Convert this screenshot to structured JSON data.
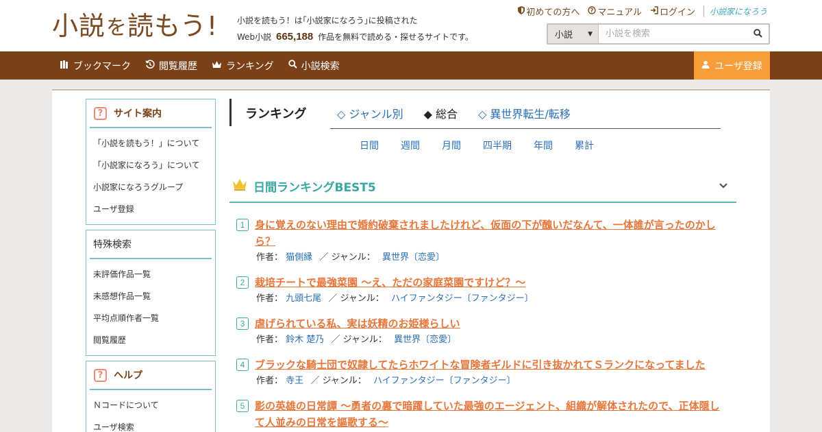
{
  "header": {
    "logo_parts": [
      "小説",
      "を",
      "読もう!"
    ],
    "tagline_line1": "小説を読もう！は｢小説家になろう｣に投稿された",
    "tagline_prefix": "Web小説",
    "work_count": "665,188",
    "tagline_suffix": "作品を無料で読める・探せるサイトです。",
    "links": [
      {
        "icon": "shield-icon",
        "label": "初めての方へ"
      },
      {
        "icon": "question-circle-icon",
        "label": "マニュアル"
      },
      {
        "icon": "login-icon",
        "label": "ログイン"
      }
    ],
    "brand_link": "小説家になろう",
    "search": {
      "category": "小説",
      "placeholder": "小説を検索"
    }
  },
  "nav": {
    "items": [
      {
        "icon": "books-icon",
        "label": "ブックマーク"
      },
      {
        "icon": "history-icon",
        "label": "閲覧履歴"
      },
      {
        "icon": "crown-icon",
        "label": "ランキング"
      },
      {
        "icon": "search-icon",
        "label": "小説検索"
      }
    ],
    "register": "ユーザ登録"
  },
  "sidebar": {
    "boxes": [
      {
        "title": "サイト案内",
        "items": [
          "「小説を読もう！」について",
          "「小説家になろう」について",
          "小説家になろうグループ",
          "ユーザ登録"
        ]
      },
      {
        "title": "特殊検索",
        "items": [
          "未評価作品一覧",
          "未感想作品一覧",
          "平均点順作者一覧",
          "閲覧履歴"
        ]
      },
      {
        "title": "ヘルプ",
        "items": [
          "Ｎコードについて",
          "ユーザ検索"
        ]
      }
    ]
  },
  "main": {
    "heading": "ランキング",
    "tabs": [
      "◇ ジャンル別",
      "◆ 総合",
      "◇ 異世界転生/転移"
    ],
    "active_tab": 1,
    "periods": [
      "日間",
      "週間",
      "月間",
      "四半期",
      "年間",
      "累計"
    ],
    "ranking_title": "日間ランキングBEST5",
    "author_label": "作者：",
    "genre_label": "／ ジャンル：",
    "entries": [
      {
        "rank": "1",
        "title": "身に覚えのない理由で婚約破棄されましたけれど、仮面の下が醜いだなんて、一体誰が言ったのかしら？",
        "author": "猫側縁",
        "genre": "異世界〔恋愛〕"
      },
      {
        "rank": "2",
        "title": "栽培チートで最強菜園 ～え、ただの家庭菜園ですけど？～",
        "author": "九頭七尾",
        "genre": "ハイファンタジー〔ファンタジー〕"
      },
      {
        "rank": "3",
        "title": "虐げられている私、実は妖精のお姫様らしい",
        "author": "鈴木 楚乃",
        "genre": "異世界〔恋愛〕"
      },
      {
        "rank": "4",
        "title": "ブラックな騎士団で奴隷してたらホワイトな冒険者ギルドに引き抜かれてＳランクになってました",
        "author": "寺王",
        "genre": "ハイファンタジー〔ファンタジー〕"
      },
      {
        "rank": "5",
        "title": "影の英雄の日常譚 ～勇者の裏で暗躍していた最強のエージェント、組織が解体されたので、正体隠して人並みの日常を謳歌する～",
        "author": "",
        "genre": ""
      }
    ]
  },
  "colors": {
    "brown": "#7a4119",
    "orange": "#f79d3a",
    "teal": "#3aa7a0",
    "link_blue": "#2a6fb8",
    "title_orange": "#e8763b"
  }
}
